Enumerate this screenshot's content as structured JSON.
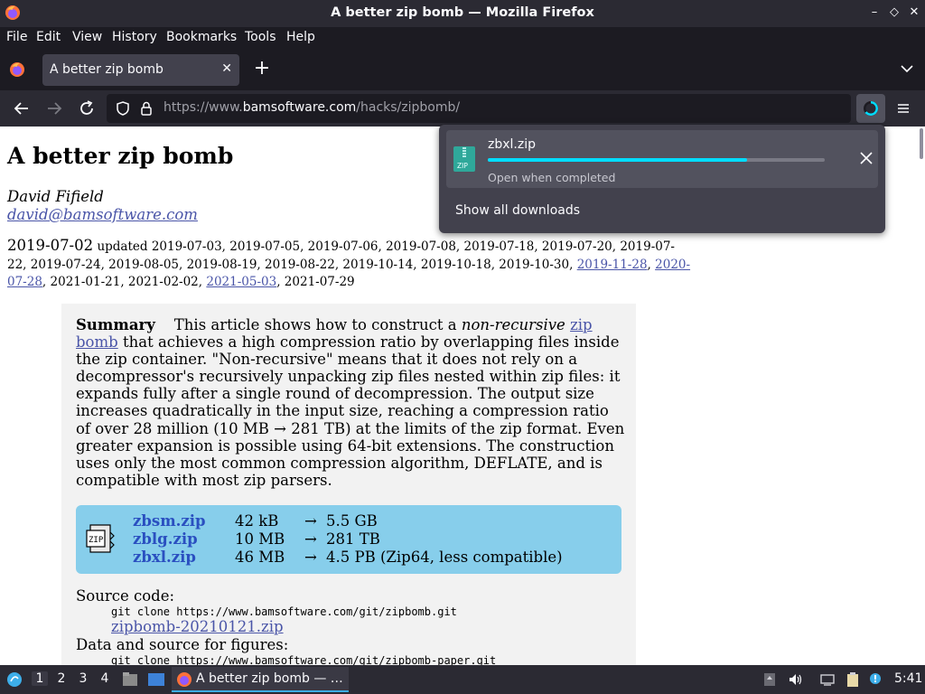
{
  "window": {
    "title": "A better zip bomb — Mozilla Firefox",
    "controls": [
      "–",
      "◇",
      "✕"
    ]
  },
  "menubar": {
    "items": [
      "File",
      "Edit",
      "View",
      "History",
      "Bookmarks",
      "Tools",
      "Help"
    ]
  },
  "tabs": [
    {
      "label": "A better zip bomb",
      "active": true
    }
  ],
  "navbar": {
    "url_prefix": "https://www.",
    "url_domain": "bamsoftware.com",
    "url_path": "/hacks/zipbomb/"
  },
  "downloads_panel": {
    "file_name": "zbxl.zip",
    "status": "Open when completed",
    "progress": 0.77,
    "show_all_label": "Show all downloads",
    "badge_label": "ZIP"
  },
  "article": {
    "title": "A better zip bomb",
    "author": "David Fifield",
    "email": "david@bamsoftware.com",
    "date_main": "2019-07-02",
    "updated_prefix": "updated",
    "updated_plain_1": "2019-07-03, 2019-07-05, 2019-07-06, 2019-07-08, 2019-07-18, 2019-07-20, 2019-07-22, 2019-07-24, 2019-08-05, 2019-08-19, 2019-08-22, 2019-10-14, 2019-10-18, 2019-10-30,",
    "updated_link_1": "2019-11-28",
    "updated_link_2": "2020-07-28",
    "updated_plain_2": "2021-01-21, 2021-02-02,",
    "updated_link_3": "2021-05-03",
    "updated_plain_3": "2021-07-29",
    "summary_label": "Summary",
    "summary_part1": "This article shows how to construct a",
    "summary_italic": "non-recursive",
    "summary_link": "zip bomb",
    "summary_part2": "that achieves a high compression ratio by overlapping files inside the zip container. \"Non-recursive\" means that it does not rely on a decompressor's recursively unpacking zip files nested within zip files: it expands fully after a single round of decompression. The output size increases quadratically in the input size, reaching a compression ratio of over 28 million (10 MB → 281 TB) at the limits of the zip format. Even greater expansion is possible using 64-bit extensions. The construction uses only the most common compression algorithm, DEFLATE, and is compatible with most zip parsers.",
    "files": [
      {
        "name": "zbsm.zip",
        "size": "42 kB",
        "arrow": "→",
        "result": "5.5 GB"
      },
      {
        "name": "zblg.zip",
        "size": "10 MB",
        "arrow": "→",
        "result": "281 TB"
      },
      {
        "name": "zbxl.zip",
        "size": "46 MB",
        "arrow": "→",
        "result": "4.5 PB (Zip64, less compatible)"
      }
    ],
    "source_label": "Source code:",
    "source_cmd": "git clone https://www.bamsoftware.com/git/zipbomb.git",
    "source_zip": "zipbomb-20210121.zip",
    "data_label": "Data and source for figures:",
    "data_cmd": "git clone https://www.bamsoftware.com/git/zipbomb-paper.git"
  },
  "taskbar": {
    "workspaces": [
      "1",
      "2",
      "3",
      "4"
    ],
    "active_task": "A better zip bomb — …",
    "clock": "5:41"
  }
}
